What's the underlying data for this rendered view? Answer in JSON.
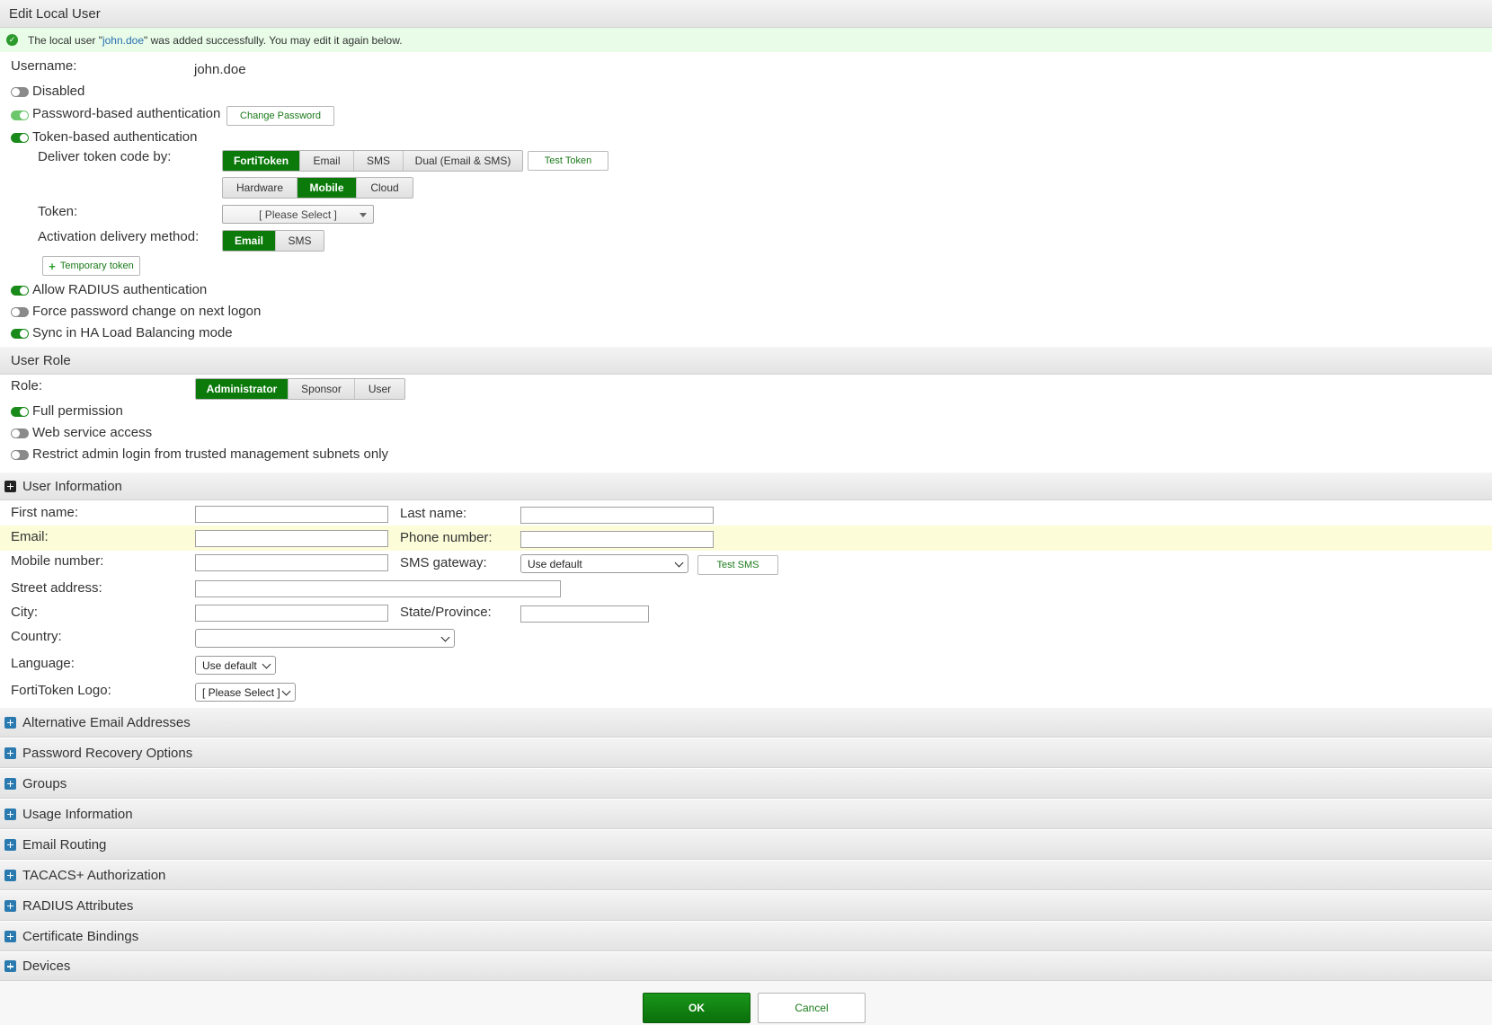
{
  "header": {
    "title": "Edit Local User"
  },
  "banner": {
    "prefix": "The local user \"",
    "username_link": "john.doe",
    "suffix": "\" was added successfully. You may edit it again below."
  },
  "account": {
    "username_label": "Username:",
    "username_value": "john.doe",
    "disabled_label": "Disabled",
    "disabled_on": false,
    "password_auth_label": "Password-based authentication",
    "password_auth_on": true,
    "change_password_label": "Change Password",
    "token_auth_label": "Token-based authentication",
    "token_auth_on": true,
    "deliver_label": "Deliver token code by:",
    "deliver_options": [
      "FortiToken",
      "Email",
      "SMS",
      "Dual (Email & SMS)"
    ],
    "deliver_selected": "FortiToken",
    "test_token_label": "Test Token",
    "token_type_options": [
      "Hardware",
      "Mobile",
      "Cloud"
    ],
    "token_type_selected": "Mobile",
    "token_label": "Token:",
    "token_select_value": "[ Please Select ]",
    "activation_label": "Activation delivery method:",
    "activation_options": [
      "Email",
      "SMS"
    ],
    "activation_selected": "Email",
    "temporary_token_label": "Temporary token",
    "allow_radius_label": "Allow RADIUS authentication",
    "allow_radius_on": true,
    "force_pw_label": "Force password change on next logon",
    "force_pw_on": false,
    "sync_ha_label": "Sync in HA Load Balancing mode",
    "sync_ha_on": true
  },
  "user_role": {
    "section_title": "User Role",
    "role_label": "Role:",
    "role_options": [
      "Administrator",
      "Sponsor",
      "User"
    ],
    "role_selected": "Administrator",
    "full_permission_label": "Full permission",
    "full_permission_on": true,
    "web_service_label": "Web service access",
    "web_service_on": false,
    "restrict_admin_label": "Restrict admin login from trusted management subnets only",
    "restrict_admin_on": false
  },
  "user_info": {
    "section_title": "User Information",
    "first_name_label": "First name:",
    "last_name_label": "Last name:",
    "email_label": "Email:",
    "phone_label": "Phone number:",
    "mobile_label": "Mobile number:",
    "sms_gateway_label": "SMS gateway:",
    "sms_gateway_value": "Use default",
    "test_sms_label": "Test SMS",
    "street_label": "Street address:",
    "city_label": "City:",
    "state_label": "State/Province:",
    "country_label": "Country:",
    "country_value": "",
    "language_label": "Language:",
    "language_value": "Use default",
    "fortitoken_logo_label": "FortiToken Logo:",
    "fortitoken_logo_value": "[ Please Select ]"
  },
  "collapsed_sections": [
    "Alternative Email Addresses",
    "Password Recovery Options",
    "Groups",
    "Usage Information",
    "Email Routing",
    "TACACS+ Authorization",
    "RADIUS Attributes",
    "Certificate Bindings",
    "Devices"
  ],
  "footer": {
    "ok_label": "OK",
    "cancel_label": "Cancel"
  }
}
